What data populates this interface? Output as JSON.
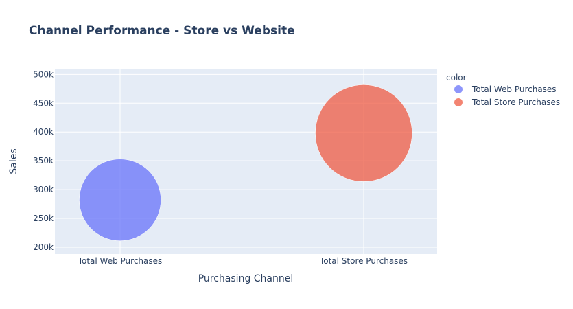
{
  "chart_data": {
    "type": "scatter",
    "title": "Channel Performance - Store vs Website",
    "xlabel": "Purchasing Channel",
    "ylabel": "Sales",
    "categories": [
      "Total Web Purchases",
      "Total Store Purchases"
    ],
    "yticks": [
      "200k",
      "250k",
      "300k",
      "350k",
      "400k",
      "450k",
      "500k"
    ],
    "ytick_values": [
      200000,
      250000,
      300000,
      350000,
      400000,
      450000,
      500000
    ],
    "ylim": [
      188000,
      510000
    ],
    "grid": true,
    "legend": {
      "title": "color",
      "position": "top-right"
    },
    "series": [
      {
        "name": "Total Web Purchases",
        "x": "Total Web Purchases",
        "y": 282000,
        "size": 118,
        "color": "#636efa"
      },
      {
        "name": "Total Store Purchases",
        "x": "Total Store Purchases",
        "y": 398000,
        "size": 140,
        "color": "#ef553b"
      }
    ],
    "colors": {
      "plot_bg": "#e5ecf6",
      "grid": "#ffffff",
      "text": "#2a3f5f"
    }
  }
}
